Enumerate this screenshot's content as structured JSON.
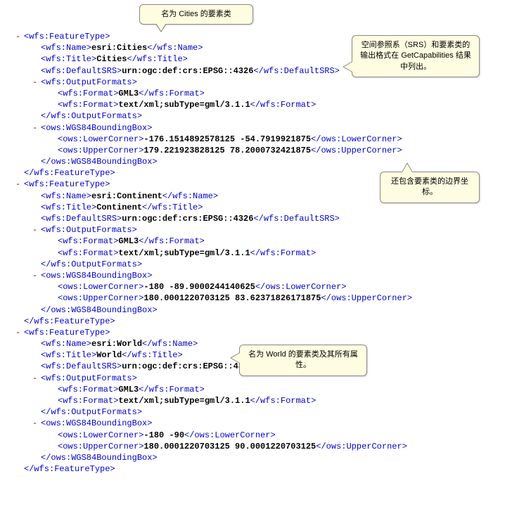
{
  "callouts": {
    "c1": "名为 Cities 的要素类",
    "c2": "空间参照系（SRS）和要素类的输出格式在 GetCapabilities 结果中列出。",
    "c3": "还包含要素类的边界坐标。",
    "c4": "名为 World 的要素类及其所有属性。"
  },
  "tags": {
    "featureTypeOpen": "<wfs:FeatureType>",
    "featureTypeClose": "</wfs:FeatureType>",
    "nameOpen": "<wfs:Name>",
    "nameClose": "</wfs:Name>",
    "titleOpen": "<wfs:Title>",
    "titleClose": "</wfs:Title>",
    "defaultSRSOpen": "<wfs:DefaultSRS>",
    "defaultSRSClose": "</wfs:DefaultSRS>",
    "outputFormatsOpen": "<wfs:OutputFormats>",
    "outputFormatsClose": "</wfs:OutputFormats>",
    "formatOpen": "<wfs:Format>",
    "formatClose": "</wfs:Format>",
    "bboxOpen": "<ows:WGS84BoundingBox>",
    "bboxClose": "</ows:WGS84BoundingBox>",
    "lowerOpen": "<ows:LowerCorner>",
    "lowerClose": "</ows:LowerCorner>",
    "upperOpen": "<ows:UpperCorner>",
    "upperClose": "</ows:UpperCorner>"
  },
  "ft": [
    {
      "name": "esri:Cities",
      "title": "Cities",
      "srs": "urn:ogc:def:crs:EPSG::4326",
      "fmt1": "GML3",
      "fmt2": "text/xml;subType=gml/3.1.1",
      "lower": "-176.1514892578125 -54.7919921875",
      "upper": "179.221923828125 78.2000732421875"
    },
    {
      "name": "esri:Continent",
      "title": "Continent",
      "srs": "urn:ogc:def:crs:EPSG::4326",
      "fmt1": "GML3",
      "fmt2": "text/xml;subType=gml/3.1.1",
      "lower": "-180 -89.9000244140625",
      "upper": "180.0001220703125 83.62371826171875"
    },
    {
      "name": "esri:World",
      "title": "World",
      "srs": "urn:ogc:def:crs:EPSG::4326",
      "fmt1": "GML3",
      "fmt2": "text/xml;subType=gml/3.1.1",
      "lower": "-180 -90",
      "upper": "180.0001220703125 90.0001220703125"
    }
  ]
}
